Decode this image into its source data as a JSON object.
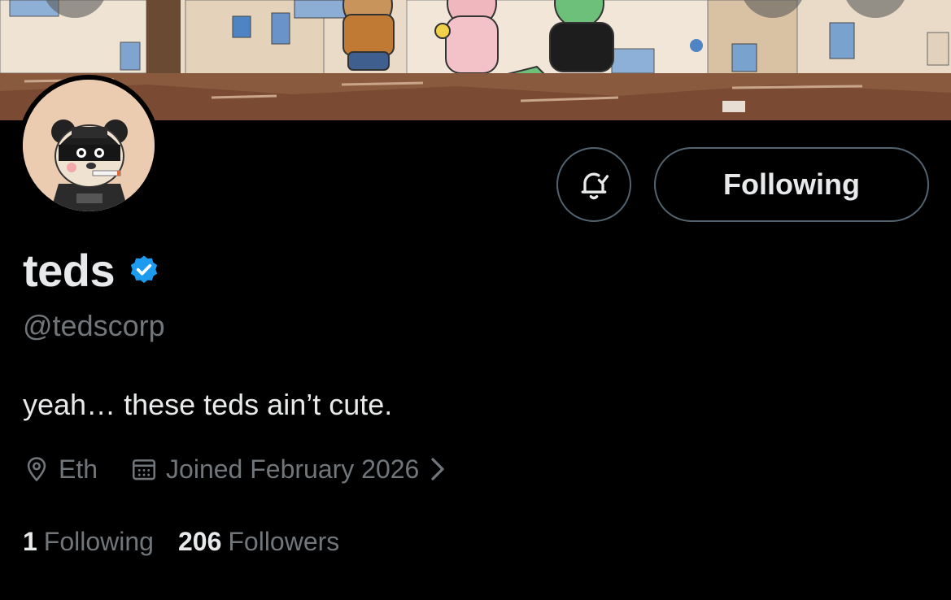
{
  "profile": {
    "display_name": "teds",
    "handle": "@tedscorp",
    "bio": "yeah… these teds ain’t cute.",
    "location": "Eth",
    "joined": "Joined February 2026",
    "verified": true
  },
  "actions": {
    "follow_label": "Following"
  },
  "stats": {
    "following_count": "1",
    "following_label": "Following",
    "followers_count": "206",
    "followers_label": "Followers"
  },
  "icons": {
    "verified": "verified-badge-icon",
    "bell": "notification-bell-check-icon",
    "location": "location-pin-icon",
    "calendar": "calendar-icon",
    "chevron": "chevron-right-icon"
  },
  "colors": {
    "background": "#000000",
    "text_primary": "#e7e9ea",
    "text_secondary": "#71767b",
    "border": "#536471",
    "verified_blue": "#1d9bf0"
  }
}
